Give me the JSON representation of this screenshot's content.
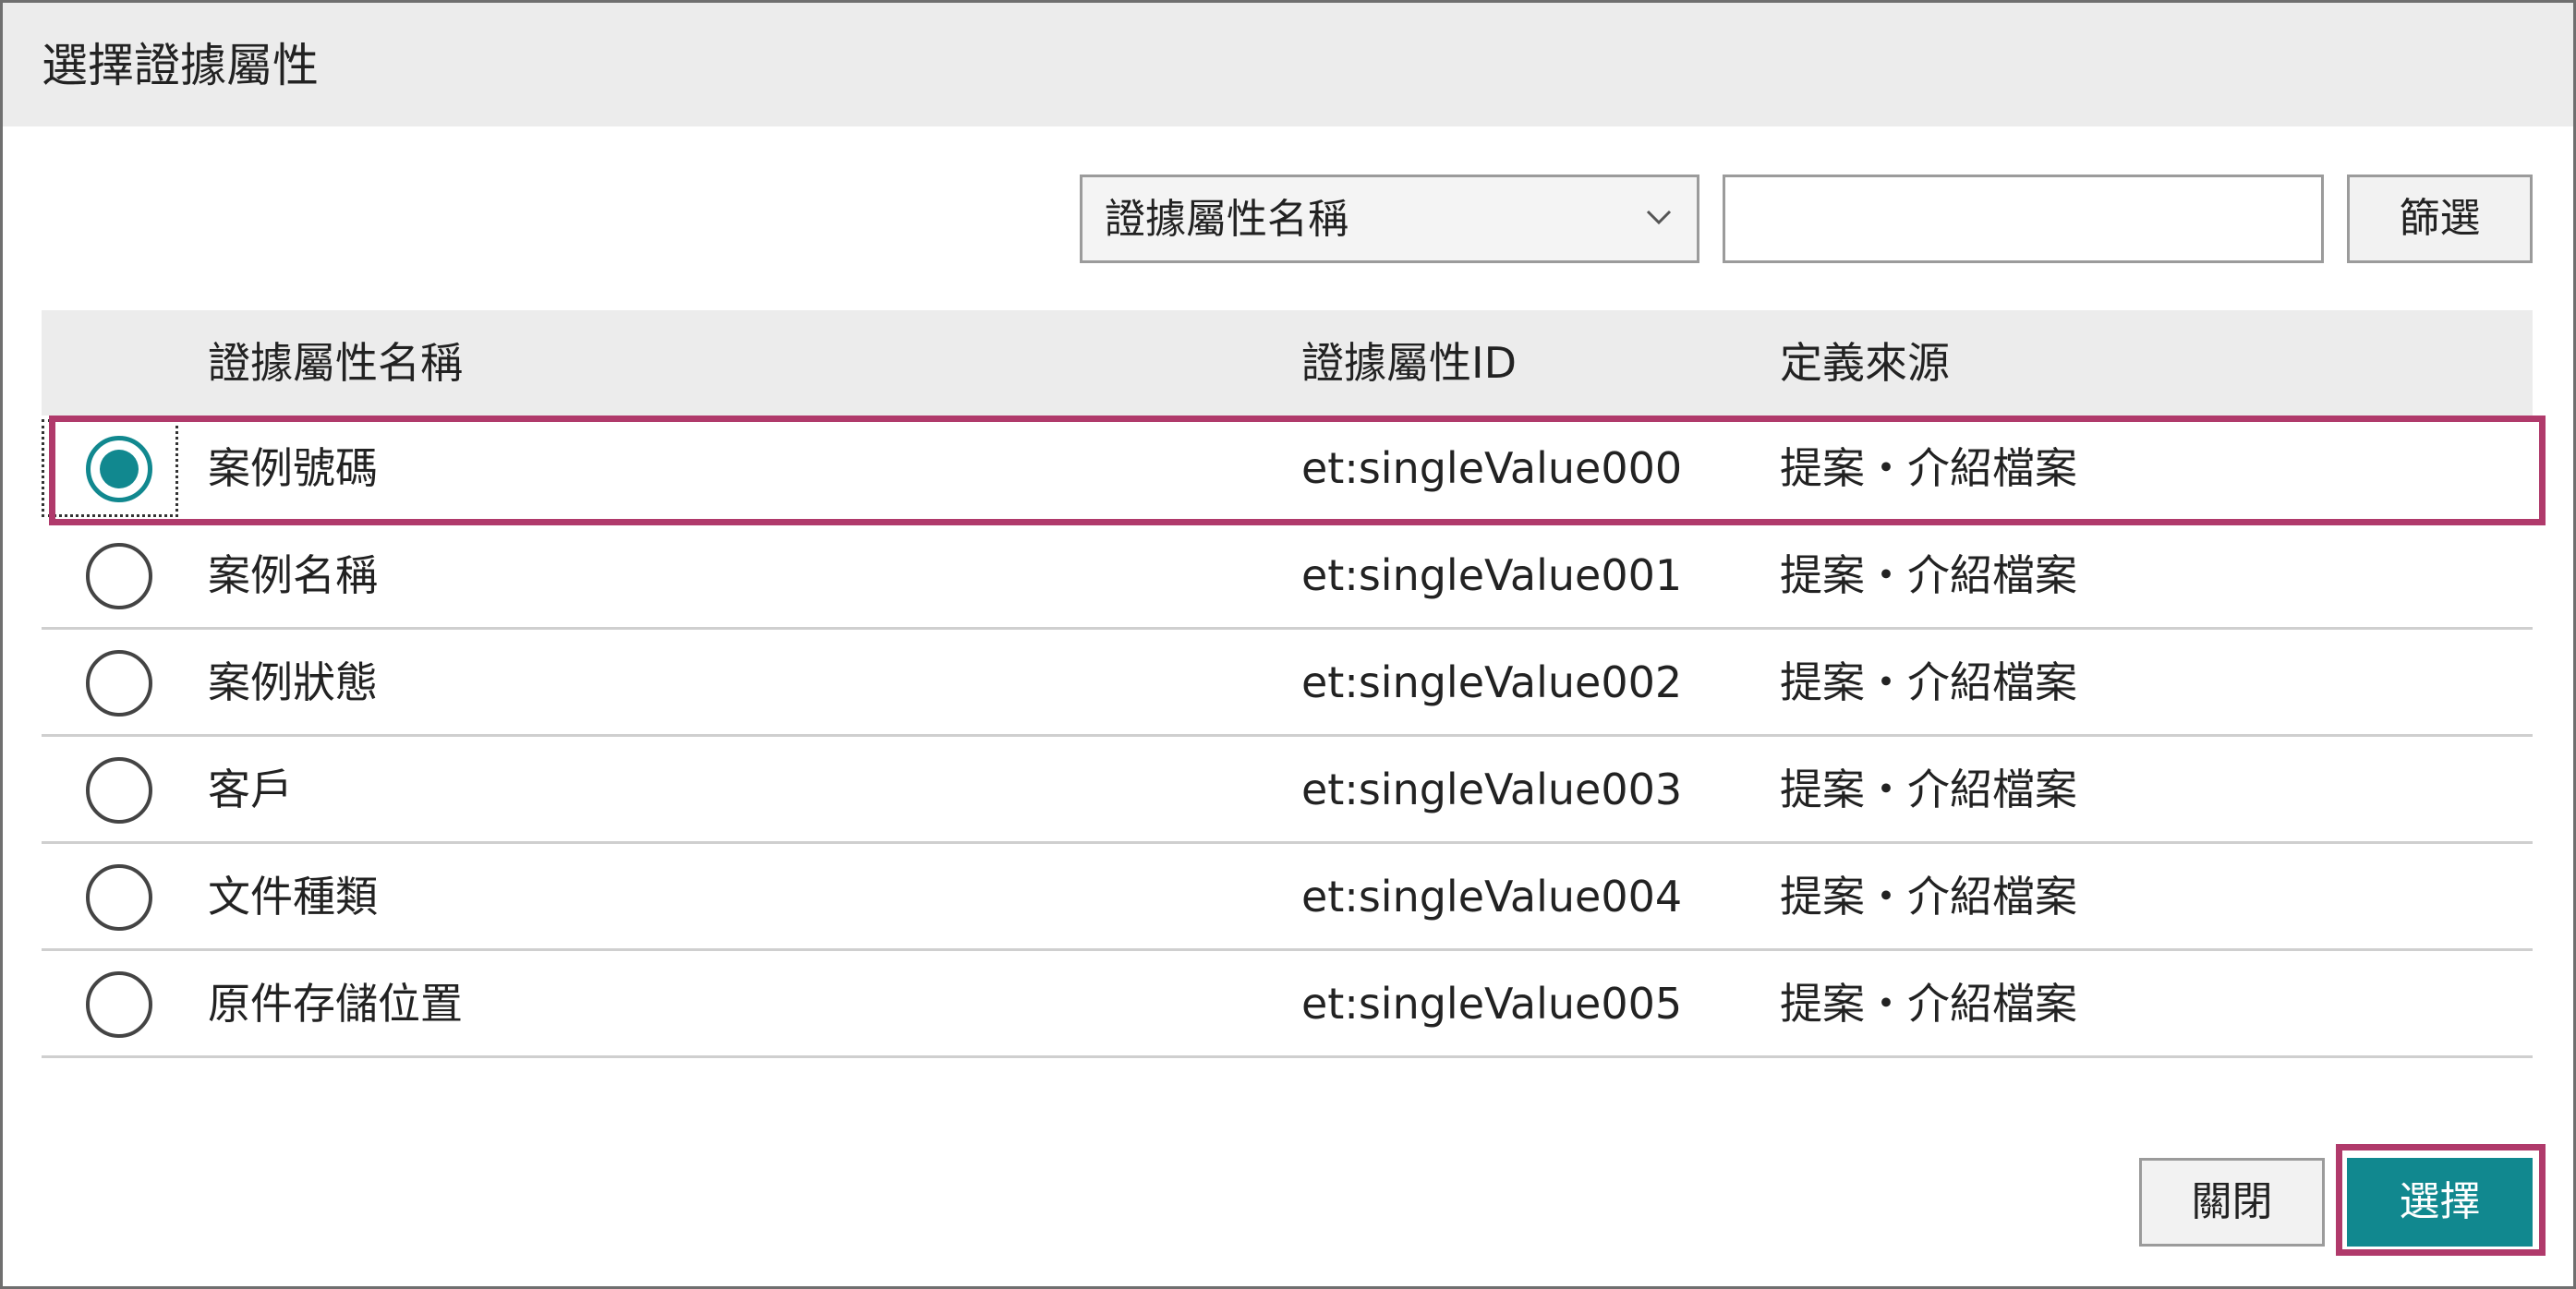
{
  "dialog": {
    "title": "選擇證據屬性"
  },
  "filter": {
    "field_selected": "證據屬性名稱",
    "input_value": "",
    "filter_label": "篩選"
  },
  "table": {
    "headers": {
      "name": "證據屬性名稱",
      "id": "證據屬性ID",
      "source": "定義來源"
    },
    "rows": [
      {
        "name": "案例號碼",
        "id": "et:singleValue000",
        "source": "提案・介紹檔案",
        "selected": true
      },
      {
        "name": "案例名稱",
        "id": "et:singleValue001",
        "source": "提案・介紹檔案",
        "selected": false
      },
      {
        "name": "案例狀態",
        "id": "et:singleValue002",
        "source": "提案・介紹檔案",
        "selected": false
      },
      {
        "name": "客戶",
        "id": "et:singleValue003",
        "source": "提案・介紹檔案",
        "selected": false
      },
      {
        "name": "文件種類",
        "id": "et:singleValue004",
        "source": "提案・介紹檔案",
        "selected": false
      },
      {
        "name": "原件存儲位置",
        "id": "et:singleValue005",
        "source": "提案・介紹檔案",
        "selected": false
      }
    ]
  },
  "footer": {
    "close_label": "關閉",
    "select_label": "選擇"
  },
  "colors": {
    "accent": "#11888f",
    "highlight": "#b03a6b"
  },
  "icons": {
    "dropdown": "chevron-down-icon"
  }
}
